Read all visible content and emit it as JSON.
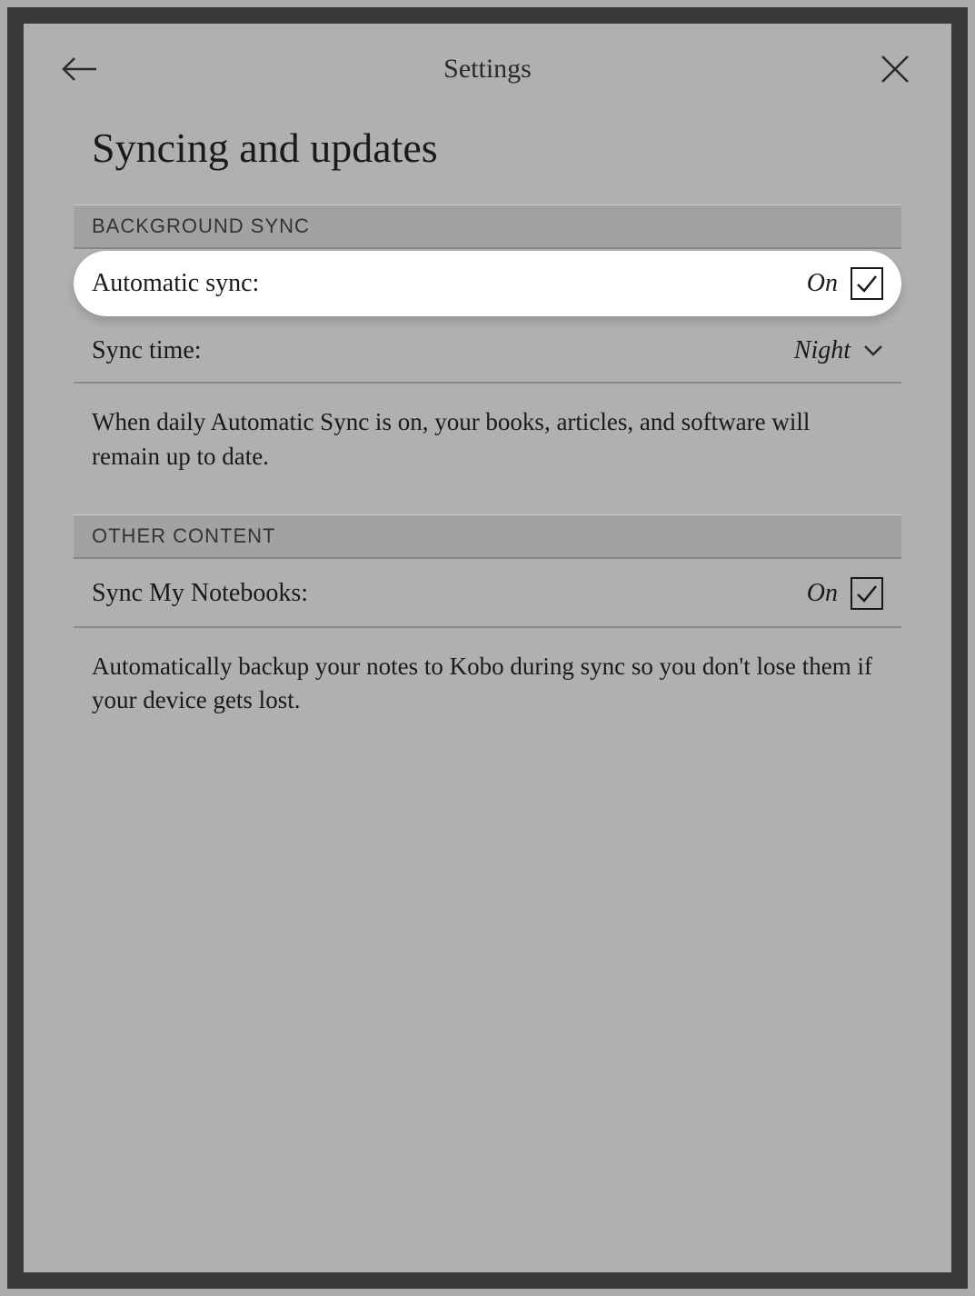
{
  "header": {
    "title": "Settings"
  },
  "page": {
    "title": "Syncing and updates"
  },
  "sections": {
    "backgroundSync": {
      "header": "BACKGROUND SYNC",
      "automaticSync": {
        "label": "Automatic sync:",
        "value": "On"
      },
      "syncTime": {
        "label": "Sync time:",
        "value": "Night"
      },
      "description": "When daily Automatic Sync is on, your books, articles, and software will remain up to date."
    },
    "otherContent": {
      "header": "OTHER CONTENT",
      "syncNotebooks": {
        "label": "Sync My Notebooks:",
        "value": "On"
      },
      "description": "Automatically backup your notes to Kobo during sync so you don't lose them if your device gets lost."
    }
  }
}
